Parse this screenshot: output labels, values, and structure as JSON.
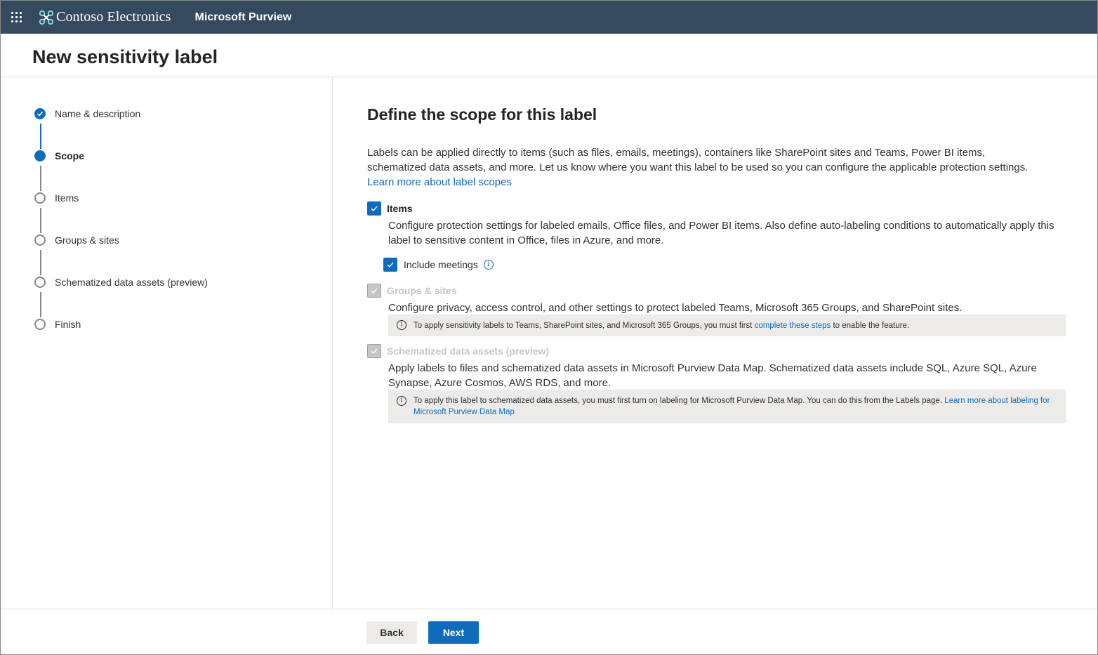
{
  "topbar": {
    "brand": "Contoso Electronics",
    "app": "Microsoft Purview"
  },
  "page": {
    "title": "New sensitivity label"
  },
  "steps": [
    {
      "label": "Name & description",
      "state": "done"
    },
    {
      "label": "Scope",
      "state": "current"
    },
    {
      "label": "Items",
      "state": "pending"
    },
    {
      "label": "Groups & sites",
      "state": "pending"
    },
    {
      "label": "Schematized data assets (preview)",
      "state": "pending"
    },
    {
      "label": "Finish",
      "state": "pending"
    }
  ],
  "main": {
    "title": "Define the scope for this label",
    "intro": "Labels can be applied directly to items (such as files, emails, meetings), containers like SharePoint sites and Teams, Power BI items, schematized data assets, and more. Let us know where you want this label to be used so you can configure the applicable protection settings.",
    "intro_link": "Learn more about label scopes",
    "items": {
      "label": "Items",
      "checked": true,
      "description": "Configure protection settings for labeled emails, Office files, and Power BI items. Also define auto-labeling conditions to automatically apply this label to sensitive content in Office, files in Azure, and more.",
      "include_meetings": {
        "label": "Include meetings",
        "checked": true
      }
    },
    "groups": {
      "label": "Groups & sites",
      "checked": true,
      "disabled": true,
      "description": "Configure privacy, access control, and other settings to protect labeled Teams, Microsoft 365 Groups, and SharePoint sites.",
      "notice_prefix": "To apply sensitivity labels to Teams, SharePoint sites, and Microsoft 365 Groups, you must first",
      "notice_link": "complete these steps",
      "notice_suffix": "to enable the feature."
    },
    "schematized": {
      "label": "Schematized data assets (preview)",
      "checked": true,
      "disabled": true,
      "description": "Apply labels to files and schematized data assets in Microsoft Purview Data Map. Schematized data assets include SQL, Azure SQL, Azure Synapse, Azure Cosmos, AWS RDS, and more.",
      "notice_prefix": "To apply this label to schematized data assets, you must first turn on labeling for Microsoft Purview Data Map. You can do this from the Labels page.",
      "notice_link": "Learn more about labeling for Microsoft Purview Data Map"
    }
  },
  "footer": {
    "back": "Back",
    "next": "Next"
  },
  "colors": {
    "accent": "#0f6cbd",
    "topbar": "#354a5f"
  }
}
